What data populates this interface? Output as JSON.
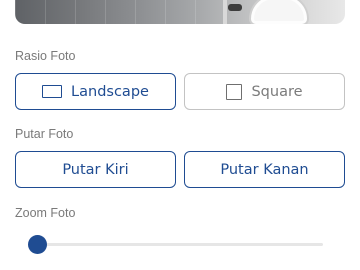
{
  "ratio": {
    "label": "Rasio Foto",
    "options": [
      {
        "label": "Landscape",
        "icon": "landscape-rectangle-icon",
        "selected": true
      },
      {
        "label": "Square",
        "icon": "square-icon",
        "selected": false
      }
    ]
  },
  "rotate": {
    "label": "Putar Foto",
    "left_label": "Putar Kiri",
    "right_label": "Putar Kanan"
  },
  "zoom": {
    "label": "Zoom Foto",
    "value": 0
  },
  "colors": {
    "accent": "#1f4c92",
    "muted_text": "#7a7a7a",
    "border_inactive": "#c3c3c3"
  }
}
